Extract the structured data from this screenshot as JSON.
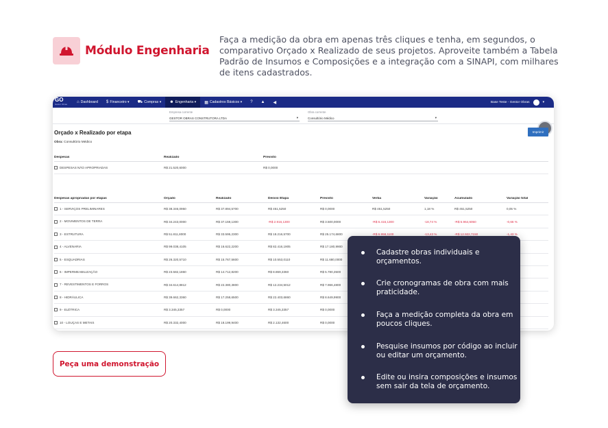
{
  "module": {
    "icon": "hard-hat-icon",
    "title": "Módulo Engenharia"
  },
  "intro": "Faça a medição da obra em apenas três cliques e tenha, em segundos, o comparativo Orçado x Realizado de seus projetos. Aproveite também a Tabela Padrão de Insumos e Composições e a integração com a SINAPI, com milhares de itens cadastrados.",
  "app": {
    "logo": "GO",
    "logo_sub": "Gestor Obras",
    "nav": [
      {
        "label": "Dashboard",
        "icon": "home-icon"
      },
      {
        "label": "Financeiro ▾",
        "icon": "dollar-icon"
      },
      {
        "label": "Compras ▾",
        "icon": "cart-icon"
      },
      {
        "label": "Engenharia ▾",
        "icon": "engineer-icon"
      },
      {
        "label": "Cadastros Básicos ▾",
        "icon": "grid-icon"
      }
    ],
    "nav_extra_icons": [
      "help-icon",
      "graduation-icon",
      "megaphone-icon"
    ],
    "user": "Base Teste - Gestor Obras",
    "company_label": "Empresa corrente",
    "company_value": "GESTOR OBRAS CONSTRUTORA LTDA",
    "work_label": "Obra corrente",
    "work_value": "Consultório Médico",
    "page_title": "Orçado x Realizado por etapa",
    "obra_label": "Obra:",
    "obra_value": "Consultório Médico",
    "print_label": "Imprimir",
    "expenses": {
      "headers": [
        "Despesas",
        "Realizado",
        "Previsto"
      ],
      "row": [
        "DESPESAS NÃO APROPRIADAS",
        "R$ 21.520,6000",
        "R$ 0,0000"
      ]
    },
    "stages": {
      "headers": [
        "Despesas apropriadas por etapas",
        "Orçado",
        "Realizado",
        "Desvio Etapa",
        "Previsto",
        "Verba",
        "Variação",
        "Acumulado",
        "Variação total"
      ],
      "rows": [
        [
          "1 - SERVIÇOS PRELIMINARES",
          "R$ 38.346,0950",
          "R$ 37.894,5700",
          "R$ 451,5250",
          "R$ 0,0000",
          "R$ 451,5250",
          "1,18 %",
          "R$ 451,5250",
          "0,05 %"
        ],
        [
          "2 - MOVIMENTOS DE TERRA",
          "R$ 34.243,0000",
          "R$ 37.159,1300",
          "-R$ 2.916,1300",
          "R$ 3.500,0000",
          "-R$ 6.416,1300",
          "-18,74 %",
          "-R$ 5.964,6050",
          "-0,66 %"
        ],
        [
          "3 - ESTRUTURA",
          "R$ 51.811,8000",
          "R$ 33.595,2300",
          "R$ 18.216,5700",
          "R$ 25.174,6800",
          "-R$ 6.958,1100",
          "-13,43 %",
          "-R$ 12.922,7150",
          "-1,43 %"
        ],
        [
          "4 - ALVENARIA",
          "R$ 99.038,4105",
          "R$ 16.622,2200",
          "R$ 82.416,1905",
          "R$ 17.180,9900",
          "",
          "",
          "",
          ""
        ],
        [
          "5 - ESQUADRIAS",
          "R$ 26.320,5710",
          "R$ 15.767,5600",
          "R$ 10.553,0110",
          "R$ 11.680,0000",
          "",
          "",
          "",
          ""
        ],
        [
          "6 - IMPERMEABILIZAÇÃO",
          "R$ 23.582,1860",
          "R$ 14.712,8200",
          "R$ 8.869,3360",
          "R$ 5.780,3500",
          "",
          "",
          "",
          ""
        ],
        [
          "7 - REVESTIMENTOS E FORROS",
          "R$ 34.614,8812",
          "R$ 22.380,3800",
          "R$ 12.234,5012",
          "R$ 7.966,4800",
          "",
          "",
          "",
          ""
        ],
        [
          "8 - HIDRÁULICA",
          "R$ 39.662,3360",
          "R$ 17.258,6500",
          "R$ 22.403,6860",
          "R$ 8.649,9900",
          "",
          "",
          "",
          ""
        ],
        [
          "9 - ELÉTRICA",
          "R$ 3.345,3357",
          "R$ 0,0000",
          "R$ 3.345,3357",
          "R$ 0,0000",
          "",
          "",
          "",
          ""
        ],
        [
          "10 - LOUÇAS E METAIS",
          "R$ 20.332,4000",
          "R$ 18.199,9400",
          "R$ 2.132,4600",
          "R$ 0,0000",
          "",
          "",
          "",
          ""
        ]
      ]
    }
  },
  "features": [
    "Cadastre obras individuais e orçamentos.",
    "Crie cronogramas de obra com mais praticidade.",
    "Faça a medição completa da obra em poucos cliques.",
    "Pesquise insumos por código ao incluir ou editar um orçamento.",
    "Edite ou insira composições  e insumos sem sair da tela de orçamento."
  ],
  "cta": "Peça uma demonstração",
  "colors": {
    "brand_red": "#d0152e",
    "nav_blue": "#1b2b86",
    "overlay_bg": "#2c2e48",
    "negative": "#e0304a"
  }
}
